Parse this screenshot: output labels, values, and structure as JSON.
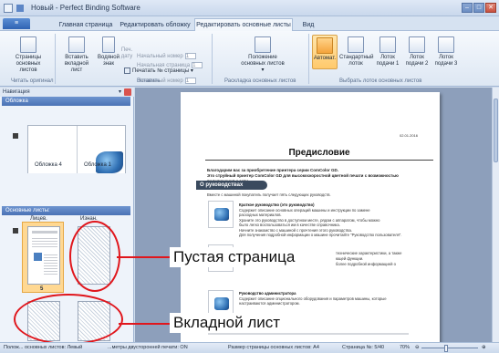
{
  "window": {
    "title": "Новый - Perfect Binding Software",
    "controls": [
      "–",
      "□",
      "✕"
    ]
  },
  "ribbon_tabs": [
    "Главная страница",
    "Редактировать обложку",
    "Редактировать основные листы",
    "Вид"
  ],
  "active_tab_index": 2,
  "ribbon": {
    "btn_body_pages": "Страницы основных листов",
    "btn_insert_tab": "Вставить вкладной лист",
    "btn_watermark": "Водяной знак",
    "btn_date": "Печ. дату",
    "print_page_num": "Печатать № страницы",
    "start_number_label": "Начальный номер",
    "start_number_value": "1",
    "start_page_label": "Начальная страница",
    "start_page_value": "1",
    "btn_position": "Положение основных листов",
    "btn_auto": "Автомат.",
    "btn_standard": "Стандартный лоток",
    "btn_tray1": "Лоток подачи 1",
    "btn_tray2": "Лоток подачи 2",
    "btn_tray3": "Лоток подачи 3",
    "group_read_original": "Читать оригинал",
    "group_insert": "Вставить",
    "group_layout": "Раскладка основных листов",
    "group_select_tray": "Выбрать лоток основных листов"
  },
  "left_pane": {
    "navigation_label": "Навигация",
    "cover_header": "Обложка",
    "cover_back_label": "Обложка 4",
    "cover_front_label": "Обложка 1",
    "body_header": "Основные листы:",
    "col_front": "Лицев.",
    "col_back": "Изнан.",
    "page_number": "5"
  },
  "document": {
    "date": "02.01.2016",
    "title": "Предисловие",
    "intro_line1": "Благодарим вас за приобретение принтера серии ComColor GD.",
    "intro_line2": "Это струйный принтер ComColor GD для высокоскоростной цветной печати с возможностью",
    "intro_line3": "подключения к сети.",
    "section_heading": "О руководствах",
    "section_intro": "Вместе с машиной покупатель получает пять следующих руководств.",
    "manual1_title": "Краткое руководство (это руководство)",
    "manual1_l1": "Содержит описание основных операций машины и инструкции по замене",
    "manual1_l2": "расходных материалов.",
    "manual1_l3": "Храните это руководство в доступном месте, рядом с аппаратом, чтобы можно",
    "manual1_l4": "было легко воспользоваться им в качестве справочника.",
    "manual1_l5": "Начните знакомство с машиной с прочтения этого руководства.",
    "manual1_l6": "Для получения подробной информации о машине прочитайте \"Руководство пользователя\".",
    "manual2_l1": "технические характеристики, а также",
    "manual2_l2": "ющей функции.",
    "manual2_l3": "более подробной информацией о",
    "manual3_title": "Руководство администратора",
    "manual3_l1": "Содержит описание опционального оборудования и параметров машины, которые",
    "manual3_l2": "настраиваются администратором."
  },
  "callouts": {
    "blank_page": "Пустая страница",
    "insert_sheet": "Вкладной лист"
  },
  "status": {
    "left": "Полож... основных листов: Левый",
    "duplex": "...метры двусторонней печати: ON",
    "paper_size": "Размер страницы основных листов: A4",
    "page": "Страница №: 5/40",
    "zoom": "70%",
    "zoom_out": "⊖",
    "zoom_in": "⊕"
  }
}
